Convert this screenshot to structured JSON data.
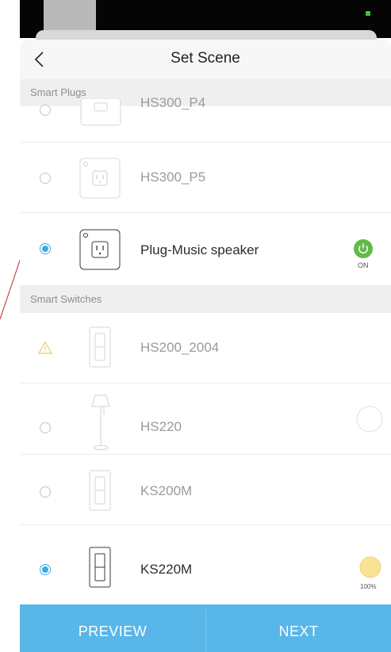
{
  "nav": {
    "title": "Set Scene",
    "back_icon": "chevron-left-icon"
  },
  "sections": {
    "plugs": "Smart Plugs",
    "switches": "Smart Switches"
  },
  "devices": {
    "hs300_p4": {
      "label": "HS300_P4",
      "selected": false,
      "icon": "outlet-icon"
    },
    "hs300_p5": {
      "label": "HS300_P5",
      "selected": false,
      "icon": "outlet-icon"
    },
    "plug_music": {
      "label": "Plug-Music speaker",
      "selected": true,
      "icon": "outlet-icon",
      "state_label": "ON",
      "state_color": "#62b947"
    },
    "hs200_2004": {
      "label": "HS200_2004",
      "icon": "switch-icon",
      "status_icon": "warning-icon"
    },
    "hs220": {
      "label": "HS220",
      "selected": false,
      "icon": "floor-lamp-icon"
    },
    "ks200m": {
      "label": "KS200M",
      "selected": false,
      "icon": "switch-icon"
    },
    "ks220m": {
      "label": "KS220M",
      "selected": true,
      "icon": "switch-icon",
      "brightness_label": "100%",
      "bulb_color": "#fae295"
    }
  },
  "footer": {
    "preview": "PREVIEW",
    "next": "NEXT"
  },
  "colors": {
    "accent": "#3fa9e4",
    "footer_bg": "#59b6e8",
    "warning": "#f3c86a"
  }
}
